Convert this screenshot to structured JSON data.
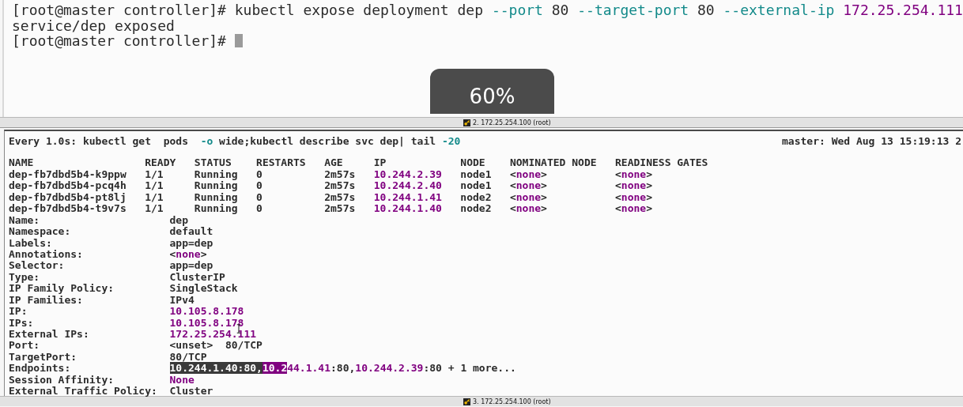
{
  "top_pane": {
    "lines": [
      {
        "cursor": false,
        "segments": [
          {
            "text": "[root@master controller]# kubectl expose deployment dep ",
            "kind": "plain"
          },
          {
            "text": "--port",
            "kind": "option"
          },
          {
            "text": " 80 ",
            "kind": "plain"
          },
          {
            "text": "--target-port",
            "kind": "option"
          },
          {
            "text": " 80 ",
            "kind": "plain"
          },
          {
            "text": "--external-ip ",
            "kind": "option"
          },
          {
            "text": "172.25.254.111",
            "kind": "literal"
          }
        ]
      },
      {
        "cursor": false,
        "segments": [
          {
            "text": "service/dep exposed",
            "kind": "plain"
          }
        ]
      },
      {
        "cursor": true,
        "segments": [
          {
            "text": "[root@master controller]# ",
            "kind": "plain"
          }
        ]
      }
    ],
    "tab_label": "2. 172.25.254.100 (root)"
  },
  "zoom_indicator": "60%",
  "bottom_pane": {
    "header": {
      "command": [
        {
          "text": "Every 1.0s: kubectl get  pods  ",
          "kind": "plain"
        },
        {
          "text": "-o",
          "kind": "option"
        },
        {
          "text": " wide;kubectl describe svc dep| tail ",
          "kind": "plain"
        },
        {
          "text": "-20",
          "kind": "option"
        }
      ],
      "clock": "master: Wed Aug 13 15:19:13 2"
    },
    "lines": [
      {
        "segments": [
          {
            "text": "NAME                  READY   STATUS    RESTARTS   AGE     IP            NODE    NOMINATED NODE   READINESS GATES",
            "kind": "plain"
          }
        ]
      },
      {
        "segments": [
          {
            "text": "dep-fb7dbd5b4-k9ppw   1/1     Running   0          2m57s   ",
            "kind": "plain"
          },
          {
            "text": "10.244.2.39",
            "kind": "literal"
          },
          {
            "text": "   node1   <",
            "kind": "plain"
          },
          {
            "text": "none",
            "kind": "literal"
          },
          {
            "text": ">           <",
            "kind": "plain"
          },
          {
            "text": "none",
            "kind": "literal"
          },
          {
            "text": ">",
            "kind": "plain"
          }
        ]
      },
      {
        "segments": [
          {
            "text": "dep-fb7dbd5b4-pcq4h   1/1     Running   0          2m57s   ",
            "kind": "plain"
          },
          {
            "text": "10.244.2.40",
            "kind": "literal"
          },
          {
            "text": "   node1   <",
            "kind": "plain"
          },
          {
            "text": "none",
            "kind": "literal"
          },
          {
            "text": ">           <",
            "kind": "plain"
          },
          {
            "text": "none",
            "kind": "literal"
          },
          {
            "text": ">",
            "kind": "plain"
          }
        ]
      },
      {
        "segments": [
          {
            "text": "dep-fb7dbd5b4-pt8lj   1/1     Running   0          2m57s   ",
            "kind": "plain"
          },
          {
            "text": "10.244.1.41",
            "kind": "literal"
          },
          {
            "text": "   node2   <",
            "kind": "plain"
          },
          {
            "text": "none",
            "kind": "literal"
          },
          {
            "text": ">           <",
            "kind": "plain"
          },
          {
            "text": "none",
            "kind": "literal"
          },
          {
            "text": ">",
            "kind": "plain"
          }
        ]
      },
      {
        "segments": [
          {
            "text": "dep-fb7dbd5b4-t9v7s   1/1     Running   0          2m57s   ",
            "kind": "plain"
          },
          {
            "text": "10.244.1.40",
            "kind": "literal"
          },
          {
            "text": "   node2   <",
            "kind": "plain"
          },
          {
            "text": "none",
            "kind": "literal"
          },
          {
            "text": ">           <",
            "kind": "plain"
          },
          {
            "text": "none",
            "kind": "literal"
          },
          {
            "text": ">",
            "kind": "plain"
          }
        ]
      },
      {
        "segments": [
          {
            "text": "Name:                     dep",
            "kind": "plain"
          }
        ]
      },
      {
        "segments": [
          {
            "text": "Namespace:                default",
            "kind": "plain"
          }
        ]
      },
      {
        "segments": [
          {
            "text": "Labels:                   app=dep",
            "kind": "plain"
          }
        ]
      },
      {
        "segments": [
          {
            "text": "Annotations:              <",
            "kind": "plain"
          },
          {
            "text": "none",
            "kind": "literal"
          },
          {
            "text": ">",
            "kind": "plain"
          }
        ]
      },
      {
        "segments": [
          {
            "text": "Selector:                 app=dep",
            "kind": "plain"
          }
        ]
      },
      {
        "segments": [
          {
            "text": "Type:                     ClusterIP",
            "kind": "plain"
          }
        ]
      },
      {
        "segments": [
          {
            "text": "IP Family Policy:         SingleStack",
            "kind": "plain"
          }
        ]
      },
      {
        "segments": [
          {
            "text": "IP Families:              IPv4",
            "kind": "plain"
          }
        ]
      },
      {
        "segments": [
          {
            "text": "IP:                       ",
            "kind": "plain"
          },
          {
            "text": "10.105.8.178",
            "kind": "literal"
          }
        ]
      },
      {
        "segments": [
          {
            "text": "IPs:                      ",
            "kind": "plain"
          },
          {
            "text": "10.105.8.178",
            "kind": "literal"
          }
        ]
      },
      {
        "segments": [
          {
            "text": "External IPs:             ",
            "kind": "plain"
          },
          {
            "text": "172.25.254.111",
            "kind": "literal"
          }
        ]
      },
      {
        "segments": [
          {
            "text": "Port:                     <unset>  80/TCP",
            "kind": "plain"
          }
        ]
      },
      {
        "segments": [
          {
            "text": "TargetPort:               80/TCP",
            "kind": "plain"
          }
        ]
      },
      {
        "segments": [
          {
            "text": "Endpoints:                ",
            "kind": "plain"
          },
          {
            "text": "10.244.1.40:80,",
            "kind": "selected"
          },
          {
            "text": "10.2",
            "kind": "selected-accent"
          },
          {
            "text": "44.1.41",
            "kind": "literal"
          },
          {
            "text": ":80,",
            "kind": "plain"
          },
          {
            "text": "10.244.2.39",
            "kind": "literal"
          },
          {
            "text": ":80 + 1 more...",
            "kind": "plain"
          }
        ]
      },
      {
        "segments": [
          {
            "text": "Session Affinity:         ",
            "kind": "plain"
          },
          {
            "text": "None",
            "kind": "literal"
          }
        ]
      },
      {
        "segments": [
          {
            "text": "External Traffic Policy:  Cluster",
            "kind": "plain"
          }
        ]
      }
    ],
    "tab_label": "3. 172.25.254.100 (root)"
  }
}
